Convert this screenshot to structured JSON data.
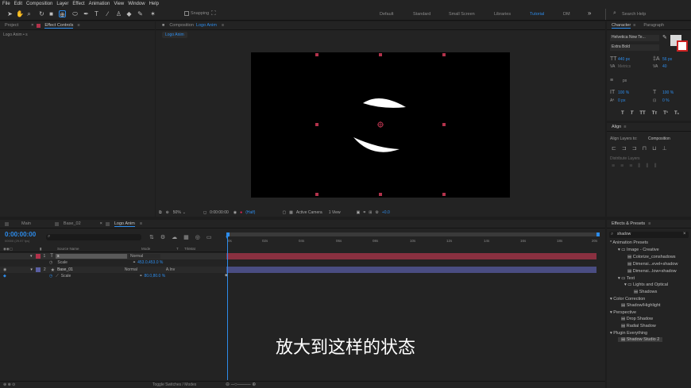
{
  "menu": [
    "File",
    "Edit",
    "Composition",
    "Layer",
    "Effect",
    "Animation",
    "View",
    "Window",
    "Help"
  ],
  "toolbar": {
    "snapping_label": "Snapping"
  },
  "workspaces": [
    "Default",
    "Standard",
    "Small Screen",
    "Libraries",
    "Tutorial",
    "DM"
  ],
  "search_help": {
    "placeholder": "Search Help"
  },
  "project_panel": {
    "project_tab": "Project",
    "effect_controls_tab": "Effect Controls",
    "layer_ref": "Logo Anim • s"
  },
  "composition_panel": {
    "title_prefix": "Composition",
    "comp_name": "Logo Anim",
    "subtab": "Logo Anim"
  },
  "viewer_bar": {
    "zoom": "50%",
    "timecode": "0:00:00:00",
    "resolution": "(Half)",
    "camera": "Active Camera",
    "views": "1 View",
    "exposure": "+0.0"
  },
  "timeline": {
    "tabs": [
      "Main",
      "Base_02",
      "Logo Anim"
    ],
    "timecode": "0:00:00:00",
    "frame_info": "00000 (29.97 fps)",
    "columns": {
      "source": "Source Name",
      "mode": "Mode",
      "t": "T",
      "trkmat": "TrkMat"
    },
    "layers": [
      {
        "num": "1",
        "name": "s",
        "mode": "Normal",
        "prop": "Scale",
        "value": "453.0,453.0 %"
      },
      {
        "num": "2",
        "name": "Base_01",
        "mode": "Normal",
        "trkmat": "A.Inv",
        "prop": "Scale",
        "value": "80.0,80.0 %"
      }
    ],
    "ruler": [
      "0s",
      "02s",
      "04s",
      "06s",
      "08s",
      "10s",
      "12s",
      "14s",
      "16s",
      "18s",
      "20s"
    ],
    "footer": "Toggle Switches / Modes"
  },
  "subtitle": "放大到这样的状态",
  "character": {
    "tab": "Character",
    "tab2": "Paragraph",
    "font": "Helvetica Now Te...",
    "style": "Extra Bold",
    "size": "440 px",
    "leading": "56 px",
    "tracking": "40",
    "metrics": "Metrics",
    "stroke_unit": "px",
    "vscale": "100 %",
    "hscale": "100 %",
    "baseline": "0 px",
    "tsume": "0 %",
    "styles": [
      "T",
      "T",
      "TT",
      "Tт",
      "T¹",
      "T₁"
    ]
  },
  "align": {
    "title": "Align",
    "align_to_label": "Align Layers to:",
    "align_to_value": "Composition",
    "distribute_label": "Distribute Layers"
  },
  "effects": {
    "title": "Effects & Presets",
    "search": "shadow",
    "items": [
      {
        "label": "* Animation Presets",
        "level": 0
      },
      {
        "label": "Image - Creative",
        "level": 1
      },
      {
        "label": "Colorize_conshadows",
        "level": 2
      },
      {
        "label": "Dimensi...evel+shadow",
        "level": 2
      },
      {
        "label": "Dimensi...low+shadow",
        "level": 2
      },
      {
        "label": "Text",
        "level": 1
      },
      {
        "label": "Lights and Optical",
        "level": 2
      },
      {
        "label": "Shadows",
        "level": 3
      },
      {
        "label": "Color Correction",
        "level": 0
      },
      {
        "label": "Shadow/Highlight",
        "level": 1
      },
      {
        "label": "Perspective",
        "level": 0
      },
      {
        "label": "Drop Shadow",
        "level": 1
      },
      {
        "label": "Radial Shadow",
        "level": 1
      },
      {
        "label": "Plugin Everything",
        "level": 0
      },
      {
        "label": "Shadow Studio 2",
        "level": 1
      }
    ]
  },
  "colors": {
    "accent": "#2d8ceb",
    "layer1": "#b2324b",
    "layer2": "#5a5fa3",
    "handles": "#b2324b"
  }
}
